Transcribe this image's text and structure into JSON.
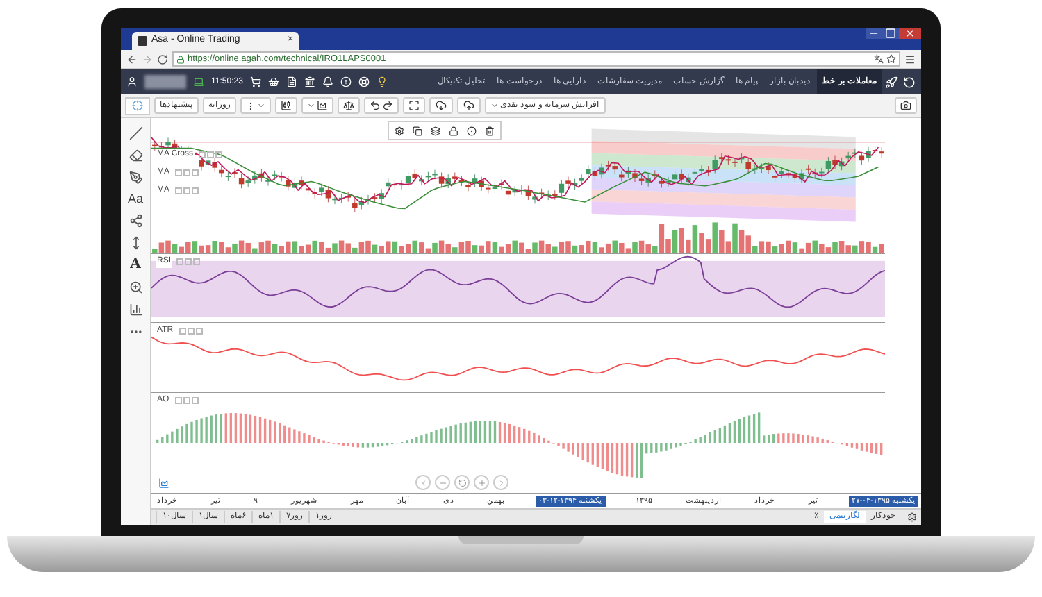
{
  "browser": {
    "tab_title": "Asa - Online Trading",
    "tab_close": "×",
    "url": "https://online.agah.com/technical/IRO1LAPS0001"
  },
  "top_nav": {
    "time": "11:50:23",
    "items": [
      {
        "label": "معاملات بر خط",
        "selected": true
      },
      {
        "label": "دیدبان بازار",
        "selected": false
      },
      {
        "label": "پیام ها",
        "selected": false
      },
      {
        "label": "گزارش حساب",
        "selected": false
      },
      {
        "label": "مدیریت سفارشات",
        "selected": false
      },
      {
        "label": "دارایی ها",
        "selected": false
      },
      {
        "label": "درخواست ها",
        "selected": false
      },
      {
        "label": "تحلیل تکنیکال",
        "selected": false
      }
    ]
  },
  "toolbar": {
    "suggestions": "پیشنهادها",
    "interval": "روزانه",
    "events_dropdown": "افزایش سرمایه و سود نقدی"
  },
  "drawing_tools": {
    "text_tool": "Aa",
    "label_tool": "A"
  },
  "indicators": {
    "main": [
      "MA Cross",
      "MA",
      "MA"
    ],
    "rsi": "RSI",
    "atr": "ATR",
    "ao": "AO"
  },
  "time_axis": [
    {
      "label": "یکشنبه ۱۳۹۵-۰۴-۲۷",
      "highlighted": true
    },
    {
      "label": "تیر",
      "highlighted": false
    },
    {
      "label": "خرداد",
      "highlighted": false
    },
    {
      "label": "اردیبهشت",
      "highlighted": false
    },
    {
      "label": "۱۳۹۵",
      "highlighted": false
    },
    {
      "label": "یکشنبه ۱۳۹۴-۱۲-۰۳",
      "highlighted": true
    },
    {
      "label": "بهمن",
      "highlighted": false
    },
    {
      "label": "دی",
      "highlighted": false
    },
    {
      "label": "آبان",
      "highlighted": false
    },
    {
      "label": "مهر",
      "highlighted": false
    },
    {
      "label": "شهریور",
      "highlighted": false
    },
    {
      "label": "۹",
      "highlighted": false
    },
    {
      "label": "تیر",
      "highlighted": false
    },
    {
      "label": "خرداد",
      "highlighted": false
    }
  ],
  "ranges": [
    "روز۱",
    "روز۷",
    "۱ماه",
    "۶ماه",
    "سال۱",
    "سال۱۰"
  ],
  "scale_options": [
    {
      "label": "خودکار",
      "selected": false
    },
    {
      "label": "لگاریتمی",
      "selected": true
    },
    {
      "label": "٪",
      "selected": false
    }
  ]
}
